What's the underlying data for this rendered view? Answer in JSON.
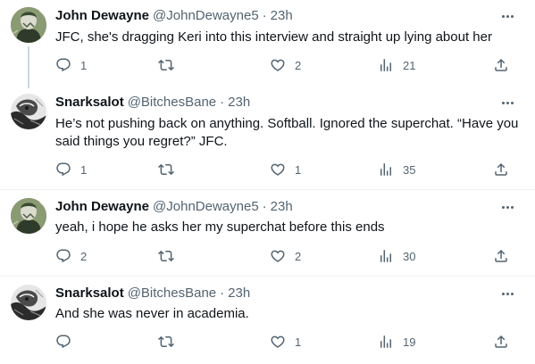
{
  "tweets": [
    {
      "name": "John Dewayne",
      "handle": "@JohnDewayne5",
      "separator": "·",
      "time": "23h",
      "text": "JFC, she's dragging Keri into this interview and straight up lying about her",
      "replies": "1",
      "retweets": "",
      "likes": "2",
      "views": "21",
      "avatar": "green-portrait-avatar"
    },
    {
      "name": "Snarksalot",
      "handle": "@BitchesBane",
      "separator": "·",
      "time": "23h",
      "text": "He’s not pushing back on anything. Softball. Ignored the superchat. “Have you said things you regret?” JFC.",
      "replies": "1",
      "retweets": "",
      "likes": "1",
      "views": "35",
      "avatar": "black-white-sketch-avatar"
    },
    {
      "name": "John Dewayne",
      "handle": "@JohnDewayne5",
      "separator": "·",
      "time": "23h",
      "text": "yeah, i hope he asks her my superchat before this ends",
      "replies": "2",
      "retweets": "",
      "likes": "2",
      "views": "30",
      "avatar": "green-portrait-avatar"
    },
    {
      "name": "Snarksalot",
      "handle": "@BitchesBane",
      "separator": "·",
      "time": "23h",
      "text": "And she was never in academia.",
      "replies": "",
      "retweets": "",
      "likes": "1",
      "views": "19",
      "avatar": "black-white-sketch-avatar"
    }
  ],
  "icons": {
    "reply": "reply-icon",
    "retweet": "retweet-icon",
    "like": "like-icon",
    "views": "views-icon",
    "share": "share-icon",
    "more": "more-options-icon"
  },
  "colors": {
    "text": "#0f1419",
    "secondary": "#536471",
    "divider": "#eff3f4",
    "thread_line": "#cfd9de"
  }
}
